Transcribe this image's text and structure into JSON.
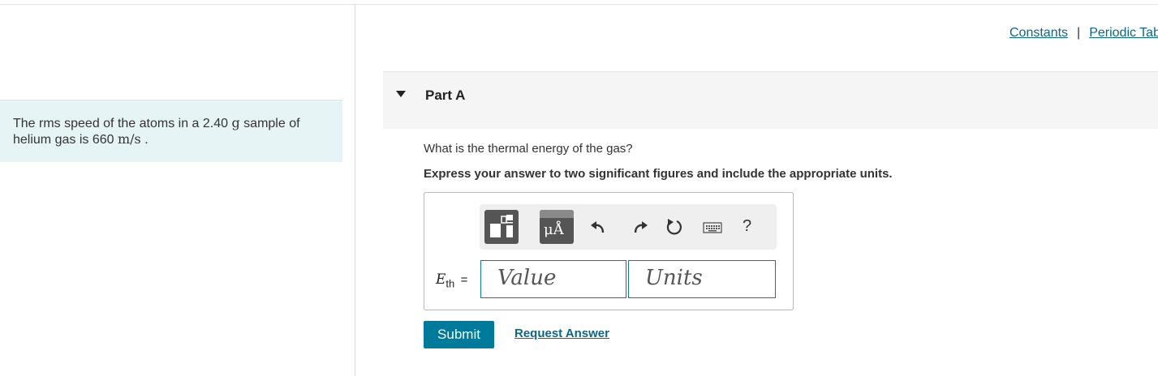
{
  "problem": {
    "text_1": "The rms speed of the atoms in a 2.40 ",
    "mass_unit": "g",
    "text_2": " sample of helium gas is 660 ",
    "speed_unit": "m/s",
    "text_3": " ."
  },
  "links": {
    "constants": "Constants",
    "separator": "|",
    "periodic": "Periodic Tab"
  },
  "part": {
    "title": "Part A",
    "question": "What is the thermal energy of the gas?",
    "instruction": "Express your answer to two significant figures and include the appropriate units."
  },
  "toolbar": {
    "units_button": "μÅ",
    "help": "?",
    "icons": [
      "templates-icon",
      "units-icon",
      "undo-icon",
      "redo-icon",
      "reset-icon",
      "keyboard-icon",
      "help-icon"
    ]
  },
  "answer": {
    "var_base": "E",
    "var_sub": "th",
    "equals": "=",
    "value_placeholder": "Value",
    "units_placeholder": "Units"
  },
  "actions": {
    "submit": "Submit",
    "request": "Request Answer"
  },
  "colors": {
    "accent": "#007a9b",
    "link": "#0b6688",
    "problem_bg": "#e6f4f5"
  }
}
